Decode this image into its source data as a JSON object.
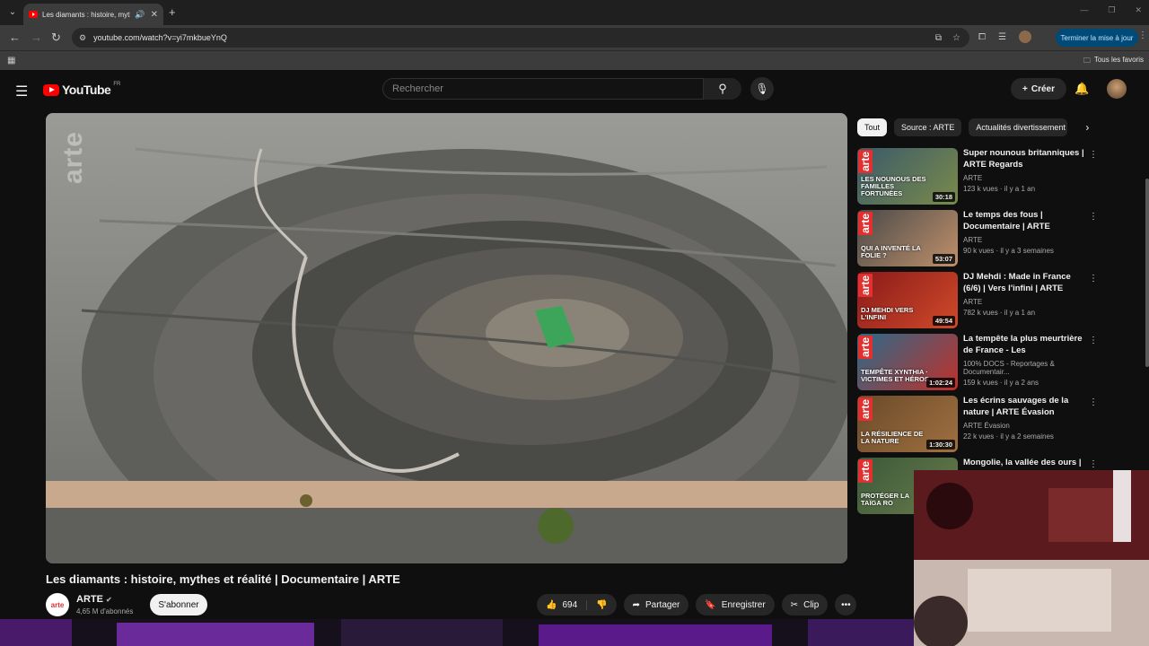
{
  "browser": {
    "tab_title": "Les diamants : histoire, myth",
    "tab_menu_icon": "chevron-down",
    "new_tab_label": "+",
    "url": "youtube.com/watch?v=yi7mkbueYnQ",
    "update_button": "Terminer la mise à jour",
    "bookmarks_all": "Tous les favoris"
  },
  "youtube": {
    "logo_text": "YouTube",
    "logo_region": "FR",
    "search_placeholder": "Rechercher",
    "create_label": "Créer"
  },
  "video": {
    "title": "Les diamants : histoire, mythes et réalité | Documentaire | ARTE",
    "watermark": "arte",
    "channel": {
      "name": "ARTE",
      "subscribers": "4,65 M d'abonnés",
      "avatar_text": "arte",
      "subscribe_label": "S'abonner"
    },
    "actions": {
      "likes": "694",
      "share": "Partager",
      "save": "Enregistrer",
      "clip": "Clip"
    }
  },
  "chips": [
    "Tout",
    "Source : ARTE",
    "Actualités divertissement"
  ],
  "recommendations": [
    {
      "title": "Super nounous britanniques | ARTE Regards",
      "channel": "ARTE",
      "meta": "123 k vues · il y a 1 an",
      "duration": "30:18",
      "thumb_text": "LES NOUNOUS DES FAMILLES FORTUNÉES",
      "colors": [
        "#3a5a6a",
        "#7a8a4a"
      ]
    },
    {
      "title": "Le temps des fous | Documentaire | ARTE",
      "channel": "ARTE",
      "meta": "90 k vues · il y a 3 semaines",
      "duration": "53:07",
      "thumb_text": "QUI A INVENTÉ LA FOLIE ?",
      "colors": [
        "#4a4a4a",
        "#c0906a"
      ]
    },
    {
      "title": "DJ Mehdi : Made in France (6/6) | Vers l'infini | ARTE",
      "channel": "ARTE",
      "meta": "782 k vues · il y a 1 an",
      "duration": "49:54",
      "thumb_text": "DJ MEHDI VERS L'INFINI",
      "colors": [
        "#8a1a1a",
        "#d04a2a"
      ]
    },
    {
      "title": "La tempête la plus meurtrière de France - Les conséquences...",
      "channel": "100% DOCS - Reportages & Documentair...",
      "meta": "159 k vues · il y a 2 ans",
      "duration": "1:02:24",
      "thumb_text": "TEMPÊTE XYNTHIA · VICTIMES ET HÉROS",
      "colors": [
        "#2a6a8a",
        "#c0302a"
      ]
    },
    {
      "title": "Les écrins sauvages de la nature | ARTE Évasion",
      "channel": "ARTE Évasion",
      "meta": "22 k vues · il y a 2 semaines",
      "duration": "1:30:30",
      "thumb_text": "LA RÉSILIENCE DE LA NATURE",
      "colors": [
        "#6a4a2a",
        "#a07040"
      ]
    },
    {
      "title": "Mongolie, la vallée des ours |",
      "channel": "",
      "meta": "",
      "duration": "",
      "thumb_text": "PROTÉGER LA TAÏGA RO",
      "colors": [
        "#3a5a3a",
        "#6a7a4a"
      ]
    }
  ]
}
